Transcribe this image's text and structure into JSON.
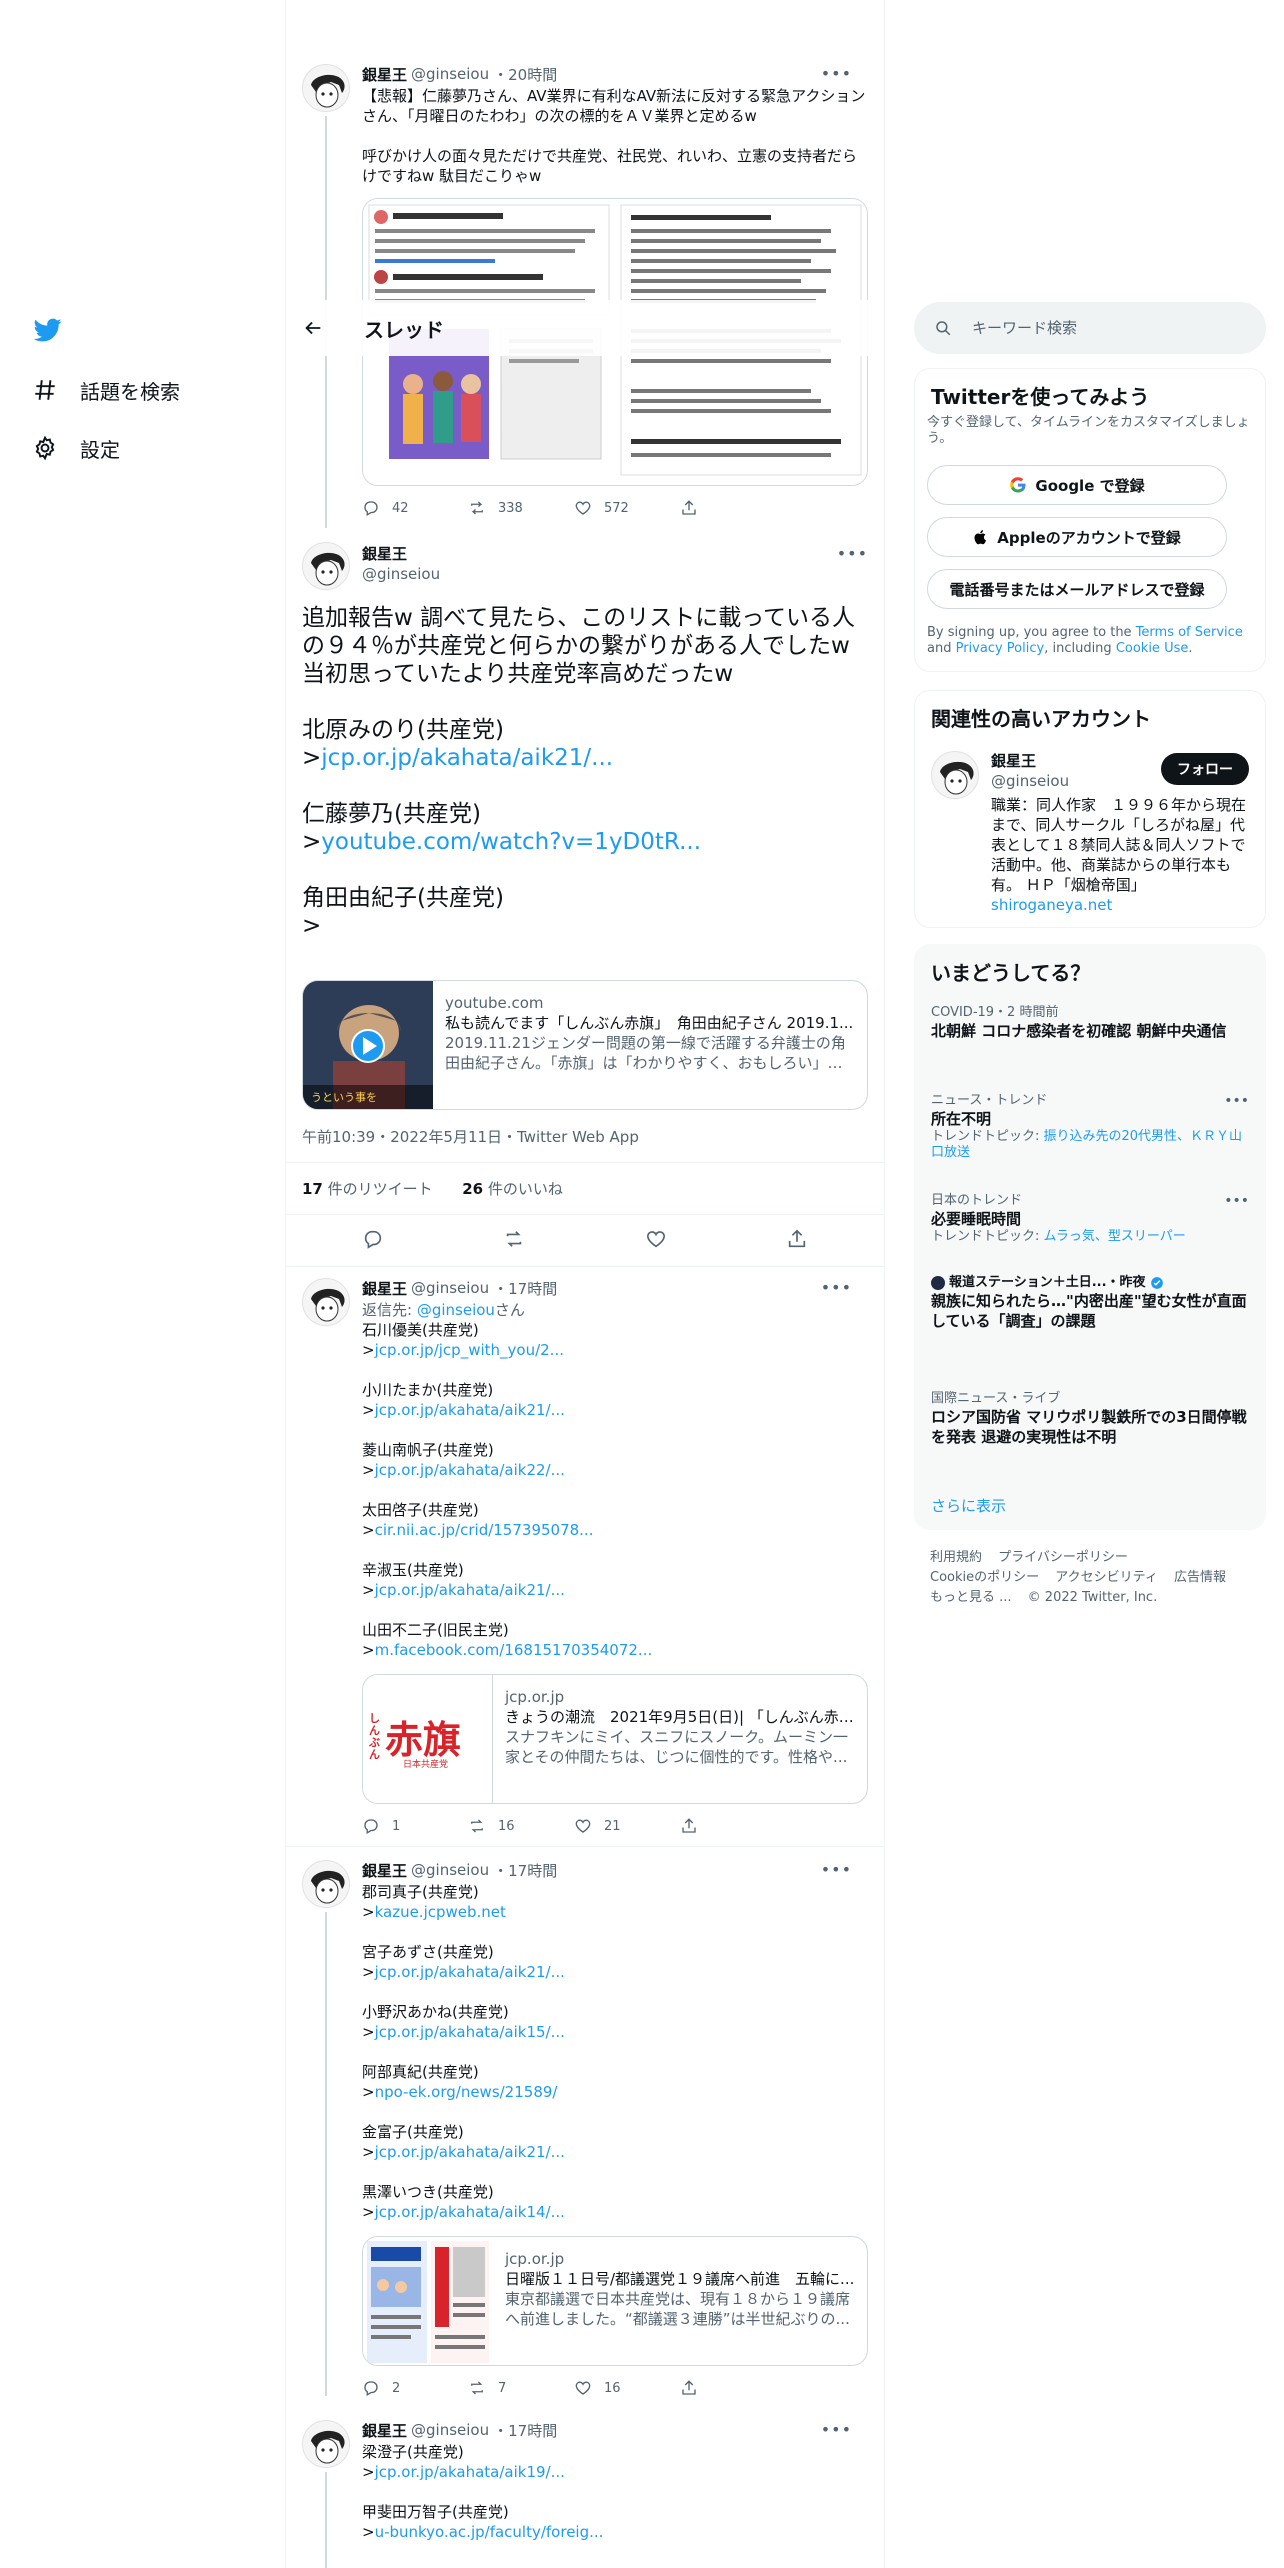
{
  "nav": {
    "explore_label": "話題を検索",
    "settings_label": "設定"
  },
  "header": {
    "title": "スレッド"
  },
  "tweet1": {
    "name": "銀星王",
    "handle": "@ginseiou",
    "time": "・20時間",
    "text": "【悲報】仁藤夢乃さん、AV業界に有利なAV新法に反対する緊急アクションさん、「月曜日のたわわ」の次の標的をＡＶ業界と定めるw\n\n呼びかけ人の面々見ただけで共産党、社民党、れいわ、立憲の支持者だらけですねw 駄目だこりゃw",
    "replies": "42",
    "retweets": "338",
    "likes": "572"
  },
  "main_tweet": {
    "name": "銀星王",
    "handle": "@ginseiou",
    "line1": "追加報告w 調べて見たら、このリストに載っている人の９４％が共産党と何らかの繋がりがある人でしたw",
    "line2": "当初思っていたより共産党率高めだったw",
    "p1_name": "北原みのり(共産党)",
    "p1_link": "jcp.or.jp/akahata/aik21/...",
    "p2_name": "仁藤夢乃(共産党)",
    "p2_link": "youtube.com/watch?v=1yD0tR...",
    "p3_name": "角田由紀子(共産党)",
    "gt": ">",
    "card": {
      "domain": "youtube.com",
      "title": "私も読んでます「しんぶん赤旗」　角田由紀子さん 2019.1...",
      "desc": "2019.11.21ジェンダー問題の第一線で活躍する弁護士の角田由紀子さん。「赤旗」は「わかりやすく、おもしろい」と..."
    },
    "timestamp": "午前10:39・2022年5月11日・Twitter Web App",
    "rt_count": "17",
    "rt_label": " 件のリツイート",
    "like_count": "26",
    "like_label": " 件のいいね"
  },
  "reply1": {
    "name": "銀星王",
    "handle": "@ginseiou",
    "time": "・17時間",
    "reply_to_prefix": "返信先: ",
    "reply_to_handle": "@ginseiou",
    "reply_to_suffix": "さん",
    "entries": [
      {
        "name": "石川優美(共産党)",
        "link": "jcp.or.jp/jcp_with_you/2..."
      },
      {
        "name": "小川たまか(共産党)",
        "link": "jcp.or.jp/akahata/aik21/..."
      },
      {
        "name": "菱山南帆子(共産党)",
        "link": "jcp.or.jp/akahata/aik22/..."
      },
      {
        "name": "太田啓子(共産党)",
        "link": "cir.nii.ac.jp/crid/157395078..."
      },
      {
        "name": "辛淑玉(共産党)",
        "link": "jcp.or.jp/akahata/aik21/..."
      },
      {
        "name": "山田不二子(旧民主党)",
        "link": "m.facebook.com/16815170354072..."
      }
    ],
    "card": {
      "domain": "jcp.or.jp",
      "title": "きょうの潮流　2021年9月5日(日)| 「しんぶん赤旗...",
      "desc": "スナフキンにミイ、スニフにスノーク。ムーミン一家とその仲間たちは、じつに個性的です。性格や...",
      "thumb_text": "赤旗",
      "thumb_small": "しんぶん",
      "thumb_sub": "日本共産党"
    },
    "replies": "1",
    "retweets": "16",
    "likes": "21"
  },
  "reply2": {
    "name": "銀星王",
    "handle": "@ginseiou",
    "time": "・17時間",
    "entries": [
      {
        "name": "郡司真子(共産党)",
        "link": "kazue.jcpweb.net"
      },
      {
        "name": "宮子あずさ(共産党)",
        "link": "jcp.or.jp/akahata/aik21/..."
      },
      {
        "name": "小野沢あかね(共産党)",
        "link": "jcp.or.jp/akahata/aik15/..."
      },
      {
        "name": "阿部真紀(共産党)",
        "link": "npo-ek.org/news/21589/"
      },
      {
        "name": "金富子(共産党)",
        "link": "jcp.or.jp/akahata/aik21/..."
      },
      {
        "name": "黒澤いつき(共産党)",
        "link": "jcp.or.jp/akahata/aik14/..."
      }
    ],
    "card": {
      "domain": "jcp.or.jp",
      "title": "日曜版１１日号/都議選党１９議席へ前進　五輪に...",
      "desc": "東京都議選で日本共産党は、現有１８から１９議席へ前進しました。“都議選３連勝”は半世紀ぶりの..."
    },
    "replies": "2",
    "retweets": "7",
    "likes": "16"
  },
  "reply3": {
    "name": "銀星王",
    "handle": "@ginseiou",
    "time": "・17時間",
    "entries": [
      {
        "name": "梁澄子(共産党)",
        "link": "jcp.or.jp/akahata/aik19/..."
      },
      {
        "name": "甲斐田万智子(共産党)",
        "link": "u-bunkyo.ac.jp/faculty/foreig..."
      }
    ]
  },
  "search": {
    "placeholder": "キーワード検索"
  },
  "signup": {
    "title": "Twitterを使ってみよう",
    "subtitle": "今すぐ登録して、タイムラインをカスタマイズしましょう。",
    "google": "Google で登録",
    "apple": "Appleのアカウントで登録",
    "phone": "電話番号またはメールアドレスで登録",
    "legal_1": "By signing up, you agree to the ",
    "tos": "Terms of Service",
    "legal_2": " and ",
    "privacy": "Privacy Policy",
    "legal_3": ", including ",
    "cookie": "Cookie Use",
    "legal_4": "."
  },
  "related": {
    "title": "関連性の高いアカウント",
    "name": "銀星王",
    "handle": "@ginseiou",
    "follow": "フォロー",
    "bio": "職業：同人作家　１９９６年から現在まで、同人サークル「しろがね屋」代表として１８禁同人誌＆同人ソフトで活動中。他、商業誌からの単行本も有。 ＨＰ「烟槍帝国」",
    "bio_link": "shiroganeya.net"
  },
  "trends": {
    "title": "いまどうしてる？",
    "items": [
      {
        "cat": "COVID-19・2 時間前",
        "title": "北朝鮮 コロナ感染者を初確認 朝鮮中央通信"
      },
      {
        "cat": "ニュース・トレンド",
        "title": "所在不明",
        "sub_prefix": "トレンドトピック: ",
        "sub": "振り込み先の20代男性、ＫＲＹ山口放送"
      },
      {
        "cat": "日本のトレンド",
        "title": "必要睡眠時間",
        "sub_prefix": "トレンドトピック: ",
        "sub": "ムラっ気、型スリーパー"
      },
      {
        "cat": "報道ステーション＋土日...・昨夜",
        "title": "親族に知られたら…\"内密出産\"望む女性が直面している「調査」の課題"
      },
      {
        "cat": "国際ニュース・ライブ",
        "title": "ロシア国防省 マリウポリ製鉄所での3日間停戦を発表 退避の実現性は不明"
      }
    ],
    "show_more": "さらに表示"
  },
  "footer": {
    "links": [
      "利用規約",
      "プライバシーポリシー",
      "Cookieのポリシー",
      "アクセシビリティ",
      "広告情報",
      "もっと見る ..."
    ],
    "copyright": "© 2022 Twitter, Inc."
  },
  "colors": {
    "accent": "#1d9bf0",
    "text": "#0f1419",
    "muted": "#536471",
    "border": "#cfd9de"
  }
}
